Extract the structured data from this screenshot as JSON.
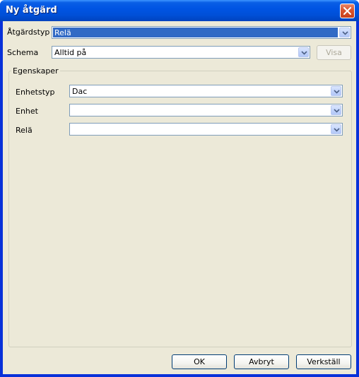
{
  "window": {
    "title": "Ny åtgärd"
  },
  "form": {
    "action_type": {
      "label": "Åtgärdstyp",
      "value": "Relä"
    },
    "schedule": {
      "label": "Schema",
      "value": "Alltid på",
      "show_button": "Visa"
    }
  },
  "properties": {
    "legend": "Egenskaper",
    "device_type": {
      "label": "Enhetstyp",
      "value": "Dac"
    },
    "device": {
      "label": "Enhet",
      "value": ""
    },
    "relay": {
      "label": "Relä",
      "value": ""
    }
  },
  "buttons": {
    "ok": "OK",
    "cancel": "Avbryt",
    "apply": "Verkställ"
  },
  "colors": {
    "title_bar": "#0054e3",
    "selection": "#316ac5",
    "dialog_bg": "#ece9d8"
  }
}
